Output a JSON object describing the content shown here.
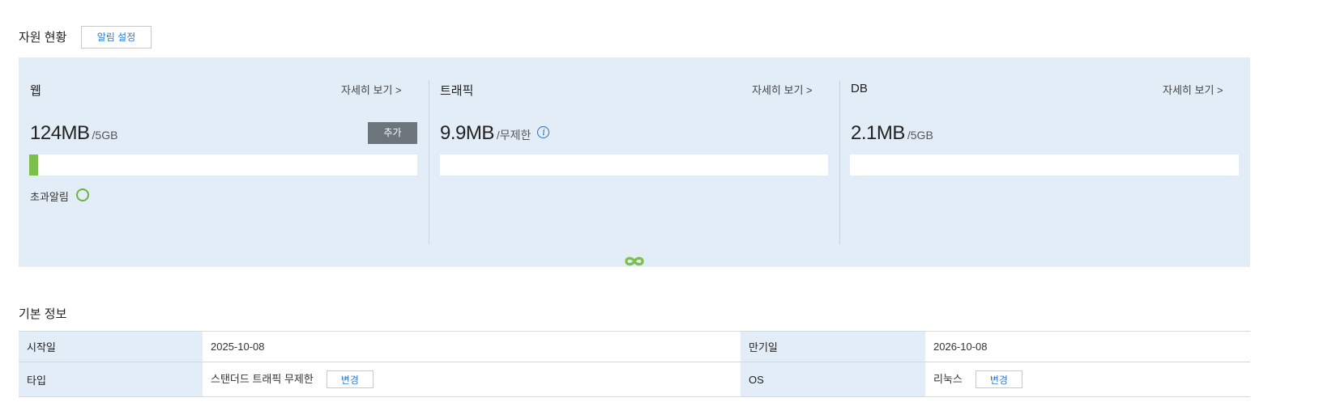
{
  "resource_section": {
    "title": "자원 현황",
    "alert_settings_label": "알림 설정"
  },
  "web": {
    "title": "웹",
    "detail_label": "자세히 보기 >",
    "usage": "124MB",
    "limit": "/5GB",
    "add_label": "추가",
    "usage_fraction": 0.024,
    "alert_label": "초과알림",
    "alert_icon": "status-ok-circle-icon"
  },
  "traffic": {
    "title": "트래픽",
    "detail_label": "자세히 보기 >",
    "usage": "9.9MB",
    "limit": "/무제한",
    "info_icon": "info-icon",
    "bar_icon": "infinity-icon"
  },
  "db": {
    "title": "DB",
    "detail_label": "자세히 보기 >",
    "usage": "2.1MB",
    "limit": "/5GB"
  },
  "basic_info": {
    "title": "기본 정보",
    "rows": [
      {
        "label1": "시작일",
        "value1": "2025-10-08",
        "label2": "만기일",
        "value2": "2026-10-08"
      },
      {
        "label1": "타입",
        "value1": "스탠더드 트래픽 무제한",
        "button1": "변경",
        "label2": "OS",
        "value2": "리눅스",
        "button2": "변경"
      }
    ]
  },
  "colors": {
    "panel_bg": "#e3edf8",
    "accent_green": "#7cc04b",
    "link_blue": "#2b7bd0",
    "add_button": "#6c747c"
  }
}
